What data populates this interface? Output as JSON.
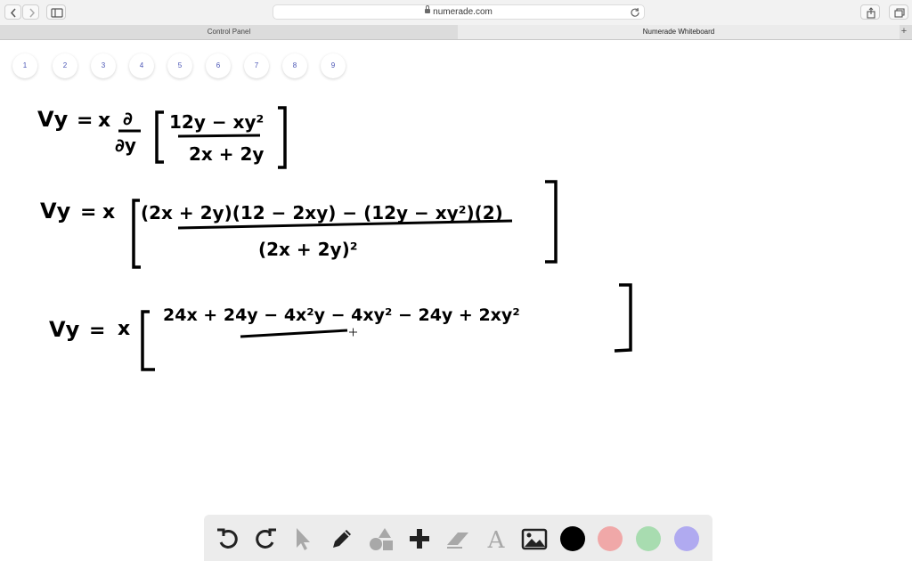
{
  "browser": {
    "url": "numerade.com"
  },
  "tabs": [
    {
      "label": "Control Panel"
    },
    {
      "label": "Numerade Whiteboard"
    }
  ],
  "pages": [
    "1",
    "2",
    "3",
    "4",
    "5",
    "6",
    "7",
    "8",
    "9"
  ],
  "handwriting": {
    "line1": {
      "lhs": "Vy",
      "eq": "=",
      "x": "x",
      "num": "∂",
      "den": "∂y",
      "frac_num": "12y − xy²",
      "frac_den": "2x + 2y"
    },
    "line2": {
      "lhs": "Vy",
      "eq": "=",
      "x": "x",
      "numerator": "(2x + 2y)(12 − 2xy) − (12y − xy²)(2)",
      "denominator": "(2x + 2y)²"
    },
    "line3": {
      "lhs": "Vy",
      "eq": "=",
      "x": "x",
      "terms": "24x + 24y − 4x²y − 4xy² − 24y + 2xy²"
    }
  },
  "toolbar": {
    "tools": [
      "undo-icon",
      "redo-icon",
      "pointer-icon",
      "pen-icon",
      "shapes-icon",
      "add-icon",
      "eraser-icon",
      "text-icon",
      "image-icon"
    ],
    "colors": [
      "#000000",
      "#f0a8a8",
      "#a8dcb0",
      "#b0aaf0"
    ]
  }
}
